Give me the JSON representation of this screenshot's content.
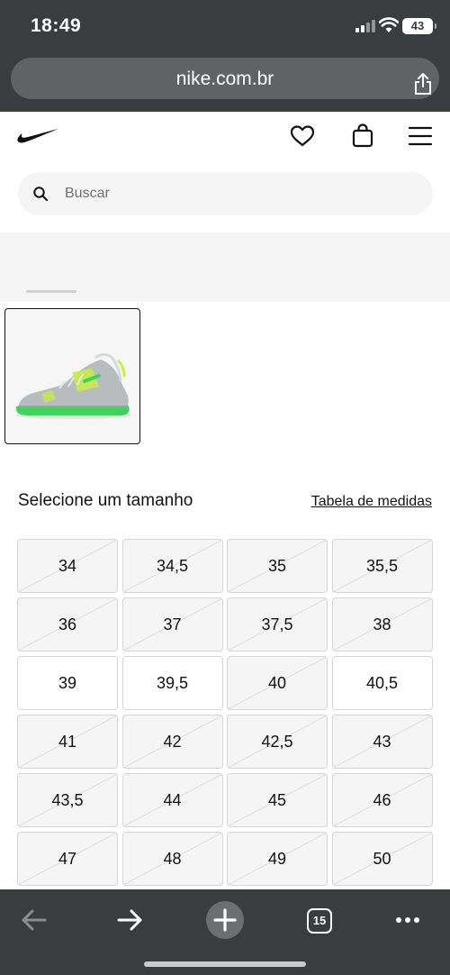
{
  "status": {
    "time": "18:49",
    "battery": "43"
  },
  "browser": {
    "url": "nike.com.br",
    "tabs_count": "15",
    "icons": [
      "share-icon",
      "back-arrow-icon",
      "forward-arrow-icon",
      "new-tab-plus-icon",
      "tabs-icon",
      "more-icon"
    ]
  },
  "header": {
    "icons": [
      "nike-swoosh-logo",
      "heart-icon",
      "bag-icon",
      "menu-icon"
    ],
    "search_placeholder": "Buscar"
  },
  "product": {
    "thumbnail": "shoe-thumbnail",
    "colors": {
      "shoe": "#b8bcbf",
      "accent": "#c9f23a",
      "sole": "#3fd35d"
    }
  },
  "sizes": {
    "title": "Selecione um tamanho",
    "guide_link": "Tabela de medidas",
    "items": [
      {
        "label": "34",
        "available": false
      },
      {
        "label": "34,5",
        "available": false
      },
      {
        "label": "35",
        "available": false
      },
      {
        "label": "35,5",
        "available": false
      },
      {
        "label": "36",
        "available": false
      },
      {
        "label": "37",
        "available": false
      },
      {
        "label": "37,5",
        "available": false
      },
      {
        "label": "38",
        "available": false
      },
      {
        "label": "39",
        "available": true
      },
      {
        "label": "39,5",
        "available": true
      },
      {
        "label": "40",
        "available": false
      },
      {
        "label": "40,5",
        "available": true
      },
      {
        "label": "41",
        "available": false
      },
      {
        "label": "42",
        "available": false
      },
      {
        "label": "42,5",
        "available": false
      },
      {
        "label": "43",
        "available": false
      },
      {
        "label": "43,5",
        "available": false
      },
      {
        "label": "44",
        "available": false
      },
      {
        "label": "45",
        "available": false
      },
      {
        "label": "46",
        "available": false
      },
      {
        "label": "47",
        "available": false
      },
      {
        "label": "48",
        "available": false
      },
      {
        "label": "49",
        "available": false
      },
      {
        "label": "50",
        "available": false
      }
    ]
  }
}
